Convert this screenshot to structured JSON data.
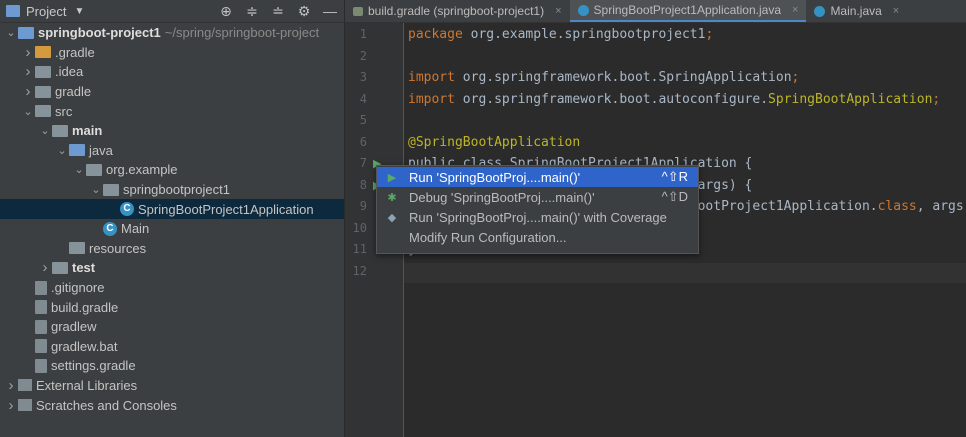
{
  "project_panel": {
    "title": "Project",
    "tools": [
      "locate-icon",
      "expand-all-icon",
      "collapse-all-icon",
      "gear-icon",
      "minimize-icon"
    ]
  },
  "tree": [
    {
      "indent": 0,
      "arrow": "open",
      "icon": "folder-blue",
      "label": "springboot-project1",
      "bold": true,
      "muted": "~/spring/springboot-project"
    },
    {
      "indent": 1,
      "arrow": "closed",
      "icon": "folder-orange",
      "label": ".gradle"
    },
    {
      "indent": 1,
      "arrow": "closed",
      "icon": "folder",
      "label": ".idea"
    },
    {
      "indent": 1,
      "arrow": "closed",
      "icon": "folder",
      "label": "gradle"
    },
    {
      "indent": 1,
      "arrow": "open",
      "icon": "folder",
      "label": "src"
    },
    {
      "indent": 2,
      "arrow": "open",
      "icon": "folder-src",
      "label": "main",
      "bold": true
    },
    {
      "indent": 3,
      "arrow": "open",
      "icon": "folder-blue",
      "label": "java"
    },
    {
      "indent": 4,
      "arrow": "open",
      "icon": "pkg",
      "label": "org.example"
    },
    {
      "indent": 5,
      "arrow": "open",
      "icon": "pkg",
      "label": "springbootproject1"
    },
    {
      "indent": 6,
      "arrow": "none",
      "icon": "class",
      "label": "SpringBootProject1Application",
      "selected": true
    },
    {
      "indent": 5,
      "arrow": "none",
      "icon": "class",
      "label": "Main"
    },
    {
      "indent": 3,
      "arrow": "none",
      "icon": "folder",
      "label": "resources"
    },
    {
      "indent": 2,
      "arrow": "closed",
      "icon": "folder-src",
      "label": "test",
      "bold": true
    },
    {
      "indent": 1,
      "arrow": "none",
      "icon": "file",
      "label": ".gitignore"
    },
    {
      "indent": 1,
      "arrow": "none",
      "icon": "file",
      "label": "build.gradle"
    },
    {
      "indent": 1,
      "arrow": "none",
      "icon": "file",
      "label": "gradlew"
    },
    {
      "indent": 1,
      "arrow": "none",
      "icon": "file",
      "label": "gradlew.bat"
    },
    {
      "indent": 1,
      "arrow": "none",
      "icon": "file",
      "label": "settings.gradle"
    },
    {
      "indent": 0,
      "arrow": "closed",
      "icon": "libs",
      "label": "External Libraries"
    },
    {
      "indent": 0,
      "arrow": "closed",
      "icon": "libs",
      "label": "Scratches and Consoles"
    }
  ],
  "tabs": [
    {
      "label": "build.gradle (springboot-project1)",
      "icon": "gradle-icon",
      "active": false
    },
    {
      "label": "SpringBootProject1Application.java",
      "icon": "class-icon",
      "active": true
    },
    {
      "label": "Main.java",
      "icon": "class-icon",
      "active": false
    }
  ],
  "code": {
    "line_numbers": [
      "1",
      "2",
      "3",
      "4",
      "5",
      "6",
      "7",
      "8",
      "9",
      "10",
      "11",
      "12"
    ],
    "lines": [
      [
        {
          "t": "package ",
          "c": "kw"
        },
        {
          "t": "org.example.springbootproject1",
          "c": "cls"
        },
        {
          "t": ";",
          "c": "kw"
        }
      ],
      [],
      [
        {
          "t": "import ",
          "c": "kw"
        },
        {
          "t": "org.springframework.boot.SpringApplication",
          "c": "cls"
        },
        {
          "t": ";",
          "c": "kw"
        }
      ],
      [
        {
          "t": "import ",
          "c": "kw"
        },
        {
          "t": "org.springframework.boot.autoconfigure.",
          "c": "cls"
        },
        {
          "t": "SpringBootApplication",
          "c": "ann"
        },
        {
          "t": ";",
          "c": "kw"
        }
      ],
      [],
      [
        {
          "t": "@SpringBootApplication",
          "c": "ann"
        }
      ],
      [
        {
          "t": "public class SpringBootProject1Application {",
          "c": "cls"
        }
      ],
      [
        {
          "t": "    public static void main(String[] args) {",
          "c": "cls"
        }
      ],
      [
        {
          "t": "        SpringApplication.run(SpringBootProject1Application.",
          "c": "cls"
        },
        {
          "t": "class",
          "c": "kw"
        },
        {
          "t": ", args",
          "c": "cls"
        }
      ],
      [
        {
          "t": "    }",
          "c": "cls"
        }
      ],
      [
        {
          "t": "}",
          "c": "cls"
        }
      ],
      []
    ]
  },
  "context_menu": {
    "items": [
      {
        "label": "Run 'SpringBootProj....main()'",
        "shortcut": "^⇧R",
        "icon": "run-icon",
        "selected": true
      },
      {
        "label": "Debug 'SpringBootProj....main()'",
        "shortcut": "^⇧D",
        "icon": "debug-icon",
        "selected": false
      },
      {
        "label": "Run 'SpringBootProj....main()' with Coverage",
        "shortcut": "",
        "icon": "coverage-icon",
        "selected": false
      },
      {
        "label": "Modify Run Configuration...",
        "shortcut": "",
        "icon": "",
        "selected": false
      }
    ]
  }
}
